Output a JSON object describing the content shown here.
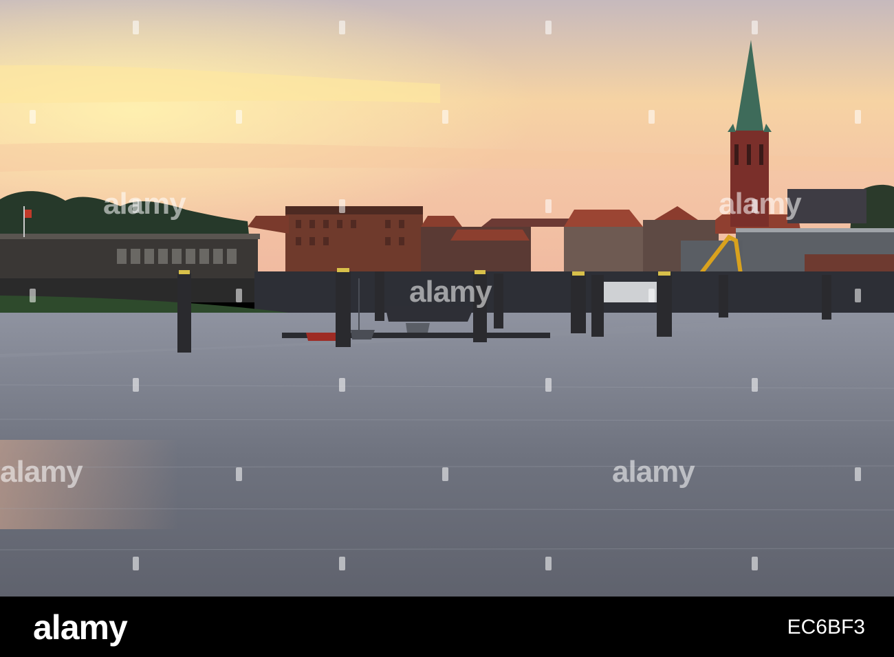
{
  "scene": {
    "colors": {
      "sky_top": "#c9bcc0",
      "sky_glow": "#fbe39a",
      "sky_horizon": "#f3c3a8",
      "water": "#717682",
      "shore_green": "#2f4a2a",
      "silhouette": "#2a2a33",
      "spire": "#3c6a58",
      "brick": "#7a3a2c"
    }
  },
  "watermark": {
    "brand": "alamy"
  },
  "footer": {
    "logo": "alamy",
    "image_id": "EC6BF3"
  }
}
